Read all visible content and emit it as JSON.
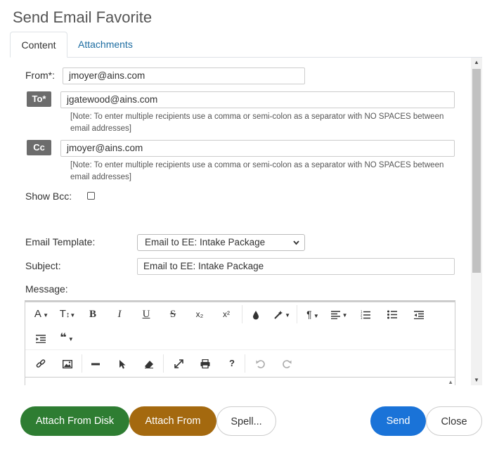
{
  "dialog": {
    "title": "Send Email Favorite"
  },
  "tabs": [
    {
      "label": "Content",
      "active": true
    },
    {
      "label": "Attachments",
      "active": false
    }
  ],
  "form": {
    "from_label": "From*:",
    "from_value": "jmoyer@ains.com",
    "to_button": "To*",
    "to_value": "jgatewood@ains.com",
    "to_note": "[Note: To enter multiple recipients use a comma or semi-colon as a separator with NO SPACES between email addresses]",
    "cc_button": "Cc",
    "cc_value": "jmoyer@ains.com",
    "cc_note": "[Note: To enter multiple recipients use a comma or semi-colon as a separator with NO SPACES between email addresses]",
    "show_bcc_label": "Show Bcc:",
    "show_bcc_checked": false,
    "template_label": "Email Template:",
    "template_value": "Email to EE: Intake Package",
    "subject_label": "Subject:",
    "subject_value": "Email to EE: Intake Package",
    "message_label": "Message:"
  },
  "editor": {
    "toolbar": {
      "font_size": "A",
      "line_height": "T",
      "bold": "B",
      "italic": "I",
      "underline": "U",
      "strike": "S",
      "subscript": "x₂",
      "superscript": "x²",
      "help": "?"
    }
  },
  "footer": {
    "attach_disk": "Attach From Disk",
    "attach_from": "Attach From",
    "spell": "Spell...",
    "send": "Send",
    "close": "Close"
  },
  "colors": {
    "green": "#2e7d32",
    "brown": "#a4690f",
    "blue": "#1a73d8",
    "link": "#1c6ca1"
  }
}
